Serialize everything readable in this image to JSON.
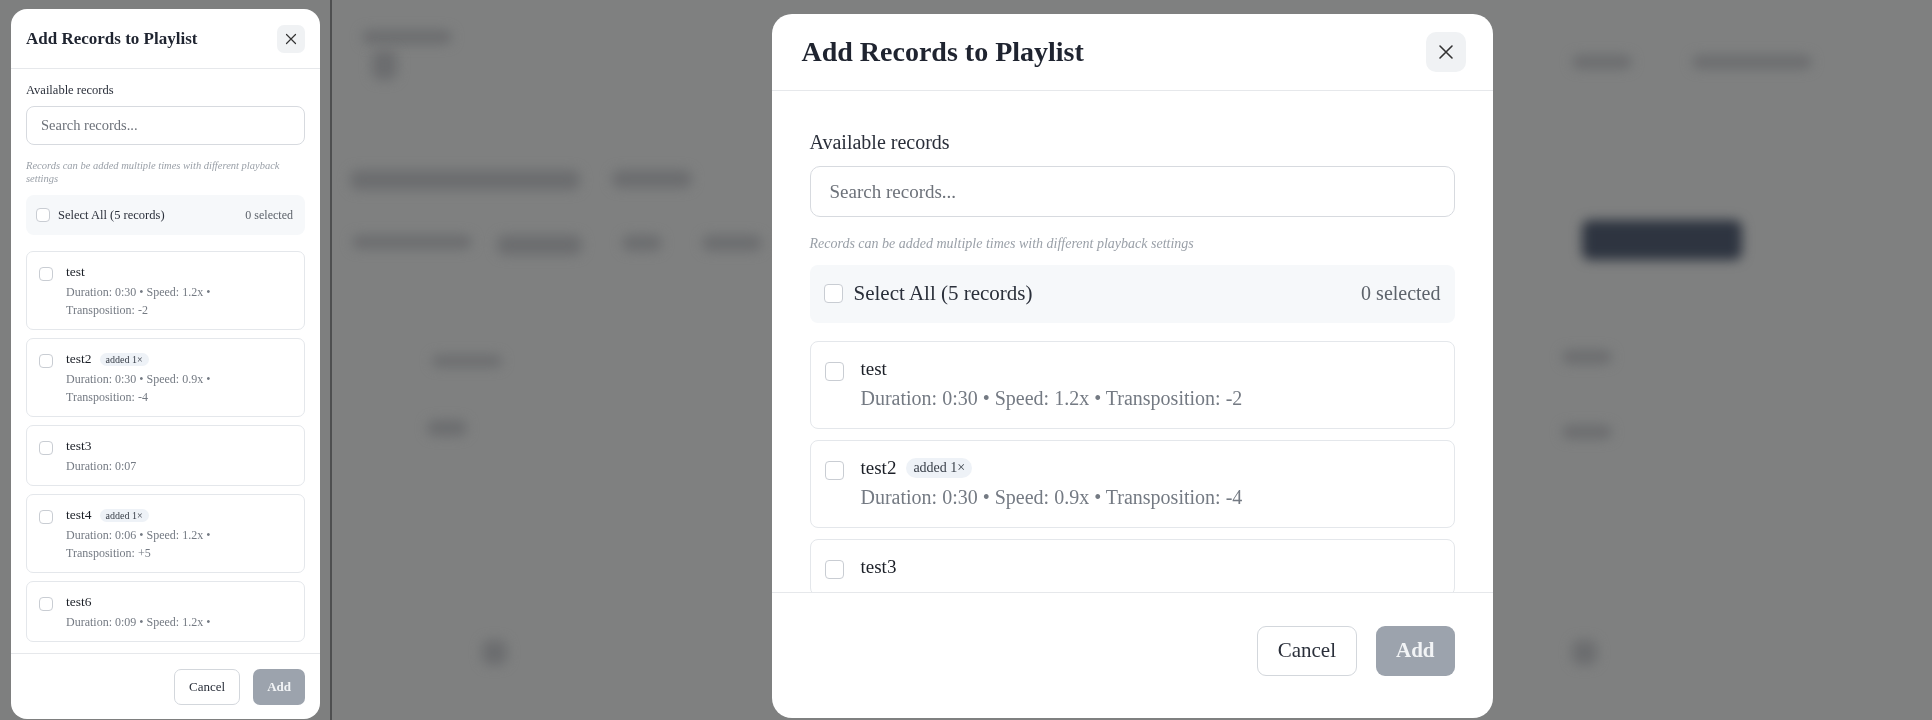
{
  "dialogs": [
    {
      "kind": "compact",
      "title": "Add Records to Playlist",
      "section_label": "Available records",
      "search": {
        "placeholder": "Search records..."
      },
      "hint": "Records can be added multiple times with different playback settings",
      "select_all": {
        "label": "Select All (5 records)",
        "checked": false,
        "count": "0 selected"
      },
      "records": [
        {
          "name": "test",
          "checked": false,
          "details": "Duration: 0:30 • Speed: 1.2x • Transposition: -2"
        },
        {
          "name": "test2",
          "checked": false,
          "badge": "added 1×",
          "details": "Duration: 0:30 • Speed: 0.9x • Transposition: -4"
        },
        {
          "name": "test3",
          "checked": false,
          "details": "Duration: 0:07"
        },
        {
          "name": "test4",
          "checked": false,
          "badge": "added 1×",
          "details": "Duration: 0:06 • Speed: 1.2x • Transposition: +5"
        },
        {
          "name": "test6",
          "checked": false,
          "details": "Duration: 0:09 • Speed: 1.2x •"
        }
      ],
      "cancel_button": {
        "label": "Cancel"
      },
      "add_button": {
        "label": "Add",
        "disabled": true
      }
    },
    {
      "kind": "wide",
      "title": "Add Records to Playlist",
      "section_label": "Available records",
      "search": {
        "placeholder": "Search records..."
      },
      "hint": "Records can be added multiple times with different playback settings",
      "select_all": {
        "label": "Select All (5 records)",
        "checked": false,
        "count": "0 selected"
      },
      "records": [
        {
          "name": "test",
          "checked": false,
          "details": "Duration: 0:30 • Speed: 1.2x • Transposition: -2"
        },
        {
          "name": "test2",
          "checked": false,
          "badge": "added 1×",
          "details": "Duration: 0:30 • Speed: 0.9x • Transposition: -4"
        },
        {
          "name": "test3",
          "checked": false
        }
      ],
      "cancel_button": {
        "label": "Cancel"
      },
      "add_button": {
        "label": "Add",
        "disabled": true
      }
    }
  ]
}
